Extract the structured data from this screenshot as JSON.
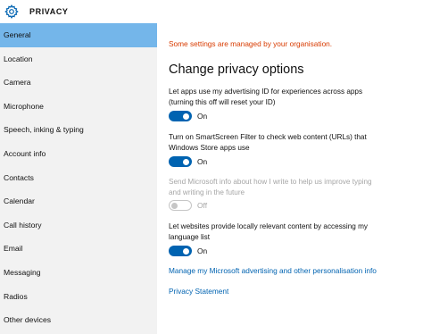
{
  "header": {
    "title": "PRIVACY",
    "icon": "gear-icon"
  },
  "sidebar": {
    "items": [
      {
        "label": "General",
        "selected": true
      },
      {
        "label": "Location"
      },
      {
        "label": "Camera"
      },
      {
        "label": "Microphone"
      },
      {
        "label": "Speech, inking & typing"
      },
      {
        "label": "Account info"
      },
      {
        "label": "Contacts"
      },
      {
        "label": "Calendar"
      },
      {
        "label": "Call history"
      },
      {
        "label": "Email"
      },
      {
        "label": "Messaging"
      },
      {
        "label": "Radios"
      },
      {
        "label": "Other devices"
      }
    ]
  },
  "main": {
    "managed_notice": "Some settings are managed by your organisation.",
    "heading": "Change privacy options",
    "options": [
      {
        "line1": "Let apps use my advertising ID for experiences across apps",
        "line2": "(turning this off will reset your ID)",
        "state": "On",
        "enabled": true
      },
      {
        "line1": "Turn on SmartScreen Filter to check web content (URLs) that",
        "line2": "Windows Store apps use",
        "state": "On",
        "enabled": true
      },
      {
        "line1": "Send Microsoft info about how I write to help us improve typing",
        "line2": "and writing in the future",
        "state": "Off",
        "enabled": false
      },
      {
        "line1": "Let websites provide locally relevant content by accessing my",
        "line2": "language list",
        "state": "On",
        "enabled": true
      }
    ],
    "links": {
      "advertising": "Manage my Microsoft advertising and other personalisation info",
      "statement": "Privacy Statement"
    }
  },
  "colors": {
    "accent": "#0063b1",
    "selection": "#74b6ea",
    "warning": "#d83b01",
    "sidebar_bg": "#f2f2f2",
    "disabled": "#a6a6a6"
  }
}
